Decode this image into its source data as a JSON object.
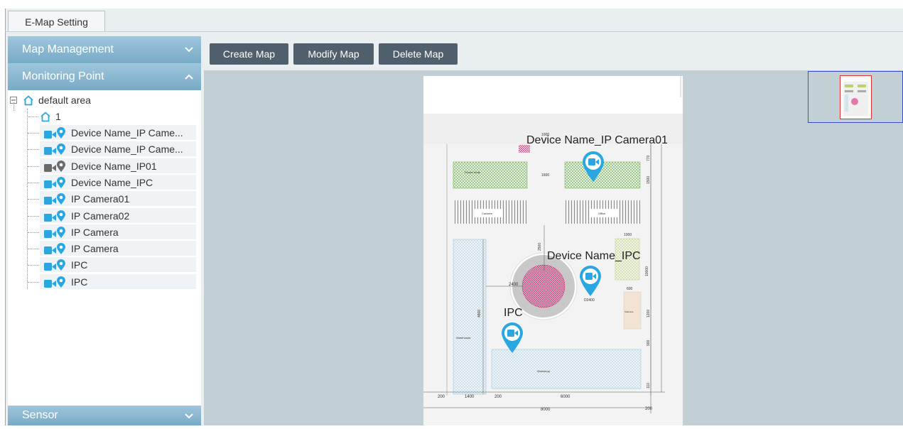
{
  "window": {
    "tab_label": "E-Map Setting"
  },
  "sidebar": {
    "map_management": "Map Management",
    "monitoring_point": "Monitoring Point",
    "sensor": "Sensor",
    "tree": {
      "root": "default area",
      "child": "1",
      "devices": [
        {
          "name": "Device Name_IP Came...",
          "cam_color": "#2aa6e0"
        },
        {
          "name": "Device Name_IP Came...",
          "cam_color": "#2aa6e0"
        },
        {
          "name": "Device Name_IP01",
          "cam_color": "#6a6a6a"
        },
        {
          "name": "Device Name_IPC",
          "cam_color": "#2aa6e0"
        },
        {
          "name": "IP Camera01",
          "cam_color": "#2aa6e0"
        },
        {
          "name": "IP Camera02",
          "cam_color": "#2aa6e0"
        },
        {
          "name": "IP Camera",
          "cam_color": "#2aa6e0"
        },
        {
          "name": "IP Camera",
          "cam_color": "#2aa6e0"
        },
        {
          "name": "IPC",
          "cam_color": "#2aa6e0"
        },
        {
          "name": "IPC",
          "cam_color": "#2aa6e0"
        }
      ]
    }
  },
  "toolbar": {
    "create": "Create Map",
    "modify": "Modify Map",
    "delete": "Delete Map"
  },
  "map": {
    "markers": [
      {
        "label": "Device Name_IP Camera01"
      },
      {
        "label": "Device Name_IPC"
      },
      {
        "label": "IPC"
      }
    ],
    "plan_labels": {
      "canteen": "Canteen",
      "office": "Office",
      "warehouse": "Warehouse",
      "workshop": "Workshop",
      "staircase": "Staircase",
      "flower_beds": "Flower beds",
      "dim_2400": "2400",
      "dim_2500": "2500",
      "dim_4800": "4800",
      "dim_1400": "1400",
      "dim_6000": "6000",
      "dim_8000": "8000",
      "dim_200": "200",
      "dim_1000": "1000",
      "dim_1600": "1600",
      "dim_10000": "10000",
      "dim_600": "600",
      "dim_900": "900",
      "dim_1200": "1200",
      "dim_1500": "1500",
      "dim_110": "110",
      "dim_770": "770",
      "dim_d2400": "D2400"
    }
  },
  "colors": {
    "accent_blue": "#2aa6e0",
    "header_blue": "#84b3cd",
    "button_dark": "#4f5f6c",
    "map_bg": "#c2cfd5"
  }
}
